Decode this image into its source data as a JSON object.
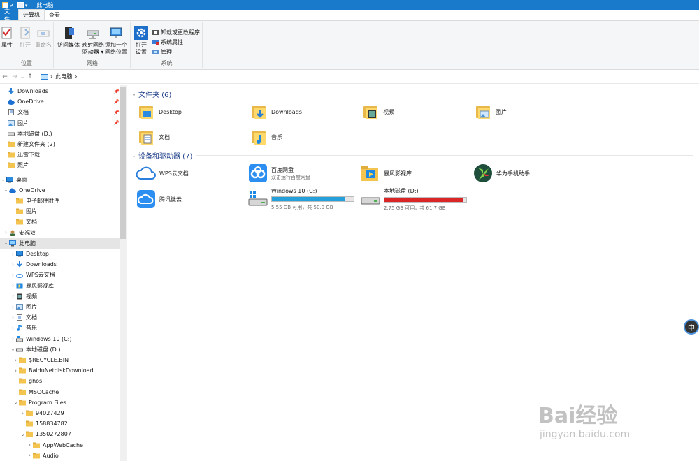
{
  "window": {
    "title": "此电脑"
  },
  "ribbon": {
    "tabs": [
      "文件",
      "计算机",
      "查看"
    ],
    "groups": {
      "location": {
        "label": "位置",
        "buttons": [
          "属性",
          "打开",
          "重命名"
        ]
      },
      "network": {
        "label": "网络",
        "buttons": [
          {
            "line1": "访问媒体",
            "line2": ""
          },
          {
            "line1": "映射网络",
            "line2": "驱动器 ▾"
          },
          {
            "line1": "添加一个",
            "line2": "网络位置"
          }
        ]
      },
      "system": {
        "label": "系统",
        "open_settings": {
          "line1": "打开",
          "line2": "设置"
        },
        "small": [
          "卸载或更改程序",
          "系统属性",
          "管理"
        ]
      }
    }
  },
  "address": {
    "path": "此电脑",
    "sep": "›"
  },
  "nav": {
    "quick": [
      {
        "label": "Downloads",
        "icon": "download-arrow-icon",
        "pinned": true
      },
      {
        "label": "OneDrive",
        "icon": "cloud-icon",
        "pinned": true
      },
      {
        "label": "文档",
        "icon": "document-icon",
        "pinned": true
      },
      {
        "label": "图片",
        "icon": "picture-icon",
        "pinned": true
      },
      {
        "label": "本地磁盘 (D:)",
        "icon": "drive-icon",
        "pinned": false
      },
      {
        "label": "新建文件夹 (2)",
        "icon": "folder-icon",
        "pinned": false
      },
      {
        "label": "迅雷下载",
        "icon": "folder-icon",
        "pinned": false
      },
      {
        "label": "照片",
        "icon": "folder-icon",
        "pinned": false
      }
    ],
    "tree": [
      {
        "label": "桌面",
        "level": 0,
        "chev": "⌄",
        "icon": "desktop-icon"
      },
      {
        "label": "OneDrive",
        "level": 1,
        "chev": "⌄",
        "icon": "cloud-icon"
      },
      {
        "label": "电子邮件附件",
        "level": 2,
        "chev": "",
        "icon": "folder-icon"
      },
      {
        "label": "图片",
        "level": 2,
        "chev": "",
        "icon": "folder-icon"
      },
      {
        "label": "文档",
        "level": 2,
        "chev": "",
        "icon": "folder-icon"
      },
      {
        "label": "安福双",
        "level": 1,
        "chev": "›",
        "icon": "user-icon"
      },
      {
        "label": "此电脑",
        "level": 1,
        "chev": "⌄",
        "icon": "pc-icon",
        "selected": true
      },
      {
        "label": "Desktop",
        "level": 2,
        "chev": "›",
        "icon": "desktop-icon"
      },
      {
        "label": "Downloads",
        "level": 2,
        "chev": "›",
        "icon": "download-arrow-icon"
      },
      {
        "label": "WPS云文档",
        "level": 2,
        "chev": "›",
        "icon": "cloud-outline-icon"
      },
      {
        "label": "暴风影视库",
        "level": 2,
        "chev": "›",
        "icon": "media-icon"
      },
      {
        "label": "视频",
        "level": 2,
        "chev": "›",
        "icon": "video-icon"
      },
      {
        "label": "图片",
        "level": 2,
        "chev": "›",
        "icon": "picture-icon"
      },
      {
        "label": "文档",
        "level": 2,
        "chev": "›",
        "icon": "document-icon"
      },
      {
        "label": "音乐",
        "level": 2,
        "chev": "›",
        "icon": "music-icon"
      },
      {
        "label": "Windows 10 (C:)",
        "level": 2,
        "chev": "›",
        "icon": "windows-drive-icon"
      },
      {
        "label": "本地磁盘 (D:)",
        "level": 2,
        "chev": "⌄",
        "icon": "drive-icon"
      },
      {
        "label": "$RECYCLE.BIN",
        "level": 3,
        "chev": "›",
        "icon": "folder-icon"
      },
      {
        "label": "BaiduNetdiskDownload",
        "level": 3,
        "chev": "›",
        "icon": "folder-icon"
      },
      {
        "label": "ghos",
        "level": 3,
        "chev": "",
        "icon": "folder-icon"
      },
      {
        "label": "MSOCache",
        "level": 3,
        "chev": "",
        "icon": "folder-icon"
      },
      {
        "label": "Program Files",
        "level": 3,
        "chev": "⌄",
        "icon": "folder-icon"
      },
      {
        "label": "94027429",
        "level": 4,
        "chev": "›",
        "icon": "folder-icon"
      },
      {
        "label": "158834782",
        "level": 4,
        "chev": "",
        "icon": "folder-icon"
      },
      {
        "label": "1350272807",
        "level": 4,
        "chev": "⌄",
        "icon": "folder-icon"
      },
      {
        "label": "AppWebCache",
        "level": 5,
        "chev": "›",
        "icon": "folder-icon"
      },
      {
        "label": "Audio",
        "level": 5,
        "chev": "›",
        "icon": "folder-icon"
      }
    ]
  },
  "content": {
    "folders_header": "文件夹 (6)",
    "folders": [
      {
        "label": "Desktop",
        "overlay": "desktop"
      },
      {
        "label": "Downloads",
        "overlay": "download"
      },
      {
        "label": "视频",
        "overlay": "film"
      },
      {
        "label": "图片",
        "overlay": "picture"
      },
      {
        "label": "文档",
        "overlay": "document"
      },
      {
        "label": "音乐",
        "overlay": "music"
      }
    ],
    "devices_header": "设备和驱动器 (7)",
    "devices": [
      {
        "label": "WPS云文档",
        "sub": "",
        "icon": "wps-cloud-icon"
      },
      {
        "label": "百度网盘",
        "sub": "双击运行百度网盘",
        "icon": "baidu-netdisk-icon"
      },
      {
        "label": "暴风影视库",
        "sub": "",
        "icon": "storm-media-icon"
      },
      {
        "label": "华为手机助手",
        "sub": "",
        "icon": "huawei-assistant-icon"
      },
      {
        "label": "腾讯微云",
        "sub": "",
        "icon": "tencent-weiyun-icon"
      },
      {
        "label": "Windows 10 (C:)",
        "sub": "5.55 GB 可用，共 50.0 GB",
        "icon": "windows-drive-icon",
        "used_fraction": 0.889,
        "bar_color": "#26a0da"
      },
      {
        "label": "本地磁盘 (D:)",
        "sub": "2.75 GB 可用，共 61.7 GB",
        "icon": "drive-icon",
        "used_fraction": 0.955,
        "bar_color": "#da2626"
      }
    ]
  },
  "ime": {
    "label": "中"
  },
  "watermark": {
    "main": "Bai经验",
    "sub": "jingyan.baidu.com"
  }
}
